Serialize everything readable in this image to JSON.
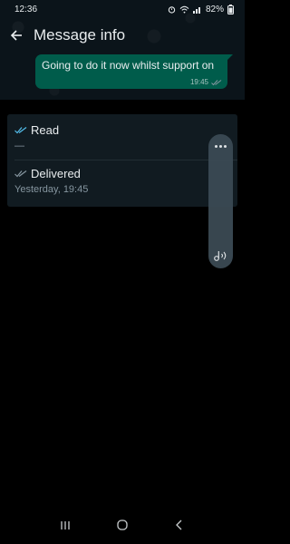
{
  "status_bar": {
    "time": "12:36",
    "battery": "82%"
  },
  "header": {
    "title": "Message info"
  },
  "message": {
    "text": "Going to do it now whilst support on",
    "time": "19:45"
  },
  "info": {
    "read_label": "Read",
    "read_value": "—",
    "delivered_label": "Delivered",
    "delivered_value": "Yesterday, 19:45"
  },
  "colors": {
    "read_ticks": "#53bdeb",
    "delivered_ticks": "#8696a0",
    "bubble": "#005c4b",
    "card": "#111b21"
  },
  "icons": {
    "back": "arrow-left-icon",
    "more": "more-vertical-icon",
    "audio": "audio-icon",
    "recent_apps": "recent-apps-icon",
    "home": "home-icon",
    "nav_back": "nav-back-icon"
  }
}
